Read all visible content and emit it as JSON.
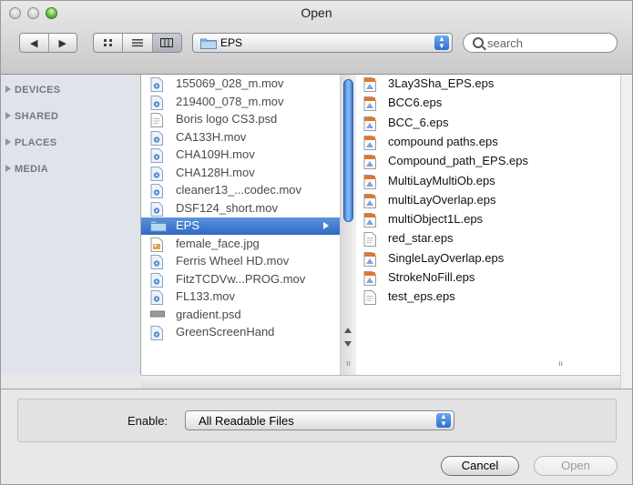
{
  "window": {
    "title": "Open"
  },
  "toolbar": {
    "path_popup_label": "EPS",
    "search_placeholder": "search"
  },
  "sidebar": {
    "items": [
      {
        "label": "DEVICES"
      },
      {
        "label": "SHARED"
      },
      {
        "label": "PLACES"
      },
      {
        "label": "MEDIA"
      }
    ]
  },
  "column1": {
    "items": [
      {
        "name": "155069_028_m.mov",
        "icon": "movie-file-icon"
      },
      {
        "name": "219400_078_m.mov",
        "icon": "movie-file-icon"
      },
      {
        "name": "Boris logo CS3.psd",
        "icon": "document-file-icon"
      },
      {
        "name": "CA133H.mov",
        "icon": "movie-file-icon"
      },
      {
        "name": "CHA109H.mov",
        "icon": "movie-file-icon"
      },
      {
        "name": "CHA128H.mov",
        "icon": "movie-file-icon"
      },
      {
        "name": "cleaner13_...codec.mov",
        "icon": "movie-file-icon"
      },
      {
        "name": "DSF124_short.mov",
        "icon": "movie-file-icon"
      },
      {
        "name": "EPS",
        "icon": "folder-icon",
        "selected": true
      },
      {
        "name": "female_face.jpg",
        "icon": "image-file-icon"
      },
      {
        "name": "Ferris Wheel HD.mov",
        "icon": "movie-file-icon"
      },
      {
        "name": "FitzTCDVw...PROG.mov",
        "icon": "movie-file-icon"
      },
      {
        "name": "FL133.mov",
        "icon": "movie-file-icon"
      },
      {
        "name": "gradient.psd",
        "icon": "psd-file-icon"
      },
      {
        "name": "GreenScreenHand",
        "icon": "movie-file-icon"
      }
    ]
  },
  "column2": {
    "items": [
      {
        "name": "3Lay3Sha_EPS.eps",
        "icon": "eps-file-icon"
      },
      {
        "name": "BCC6.eps",
        "icon": "eps-file-icon"
      },
      {
        "name": "BCC_6.eps",
        "icon": "eps-file-icon"
      },
      {
        "name": "compound paths.eps",
        "icon": "eps-file-icon"
      },
      {
        "name": "Compound_path_EPS.eps",
        "icon": "eps-file-icon"
      },
      {
        "name": "MultiLayMultiOb.eps",
        "icon": "eps-file-icon"
      },
      {
        "name": "multiLayOverlap.eps",
        "icon": "eps-file-icon"
      },
      {
        "name": "multiObject1L.eps",
        "icon": "eps-file-icon"
      },
      {
        "name": "red_star.eps",
        "icon": "document-file-icon"
      },
      {
        "name": "SingleLayOverlap.eps",
        "icon": "eps-file-icon"
      },
      {
        "name": "StrokeNoFill.eps",
        "icon": "eps-file-icon"
      },
      {
        "name": "test_eps.eps",
        "icon": "document-file-icon"
      }
    ]
  },
  "footer": {
    "enable_label": "Enable:",
    "enable_value": "All Readable Files",
    "cancel_label": "Cancel",
    "open_label": "Open"
  }
}
